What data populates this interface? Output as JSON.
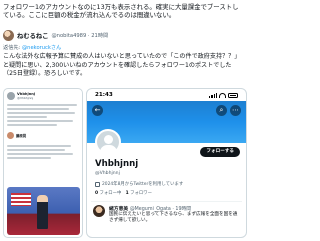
{
  "top_text": "フォロワー1のアカウントなのに13万も表示される。確実に大量課金でブーストしている。ここに巨額の税金が流れ込んでるのは間違いない。",
  "post": {
    "author_name": "ねむるねこ",
    "author_handle": "@nobita4989 · 21時間",
    "reply_to_prefix": "返信先: ",
    "reply_to_handle": "@nekoruckさん",
    "body": "こんな法外な広報予算に賛成の人はいないと思っていたので「この件で政府支持？？」と疑問に思い、2,300いいねのアカウントを確認したらフォロワー1のポストでした（25日登録）。恐ろしいです。"
  },
  "left_screenshot": {
    "name": "Vhbhjnnj",
    "handle": "@Vhbhjnnj",
    "badge_name": "藤原晃"
  },
  "profile_screenshot": {
    "status_time": "21:43",
    "follow_label": "フォローする",
    "display_name": "Vhbhjnnj",
    "handle": "@Vhbhjnnj",
    "joined": "2024年8月からTwitterを利用しています",
    "following_count": "0",
    "following_label": "フォロー中",
    "followers_count": "1",
    "followers_label": "フォロワー",
    "reply": {
      "name": "緒方恵美",
      "handle": "@Megumi_Ogata · 19時間",
      "text": "国民に伝えたいと思って下さるなら、まず広報を全面を国を通さず帰して欲しい。"
    }
  }
}
